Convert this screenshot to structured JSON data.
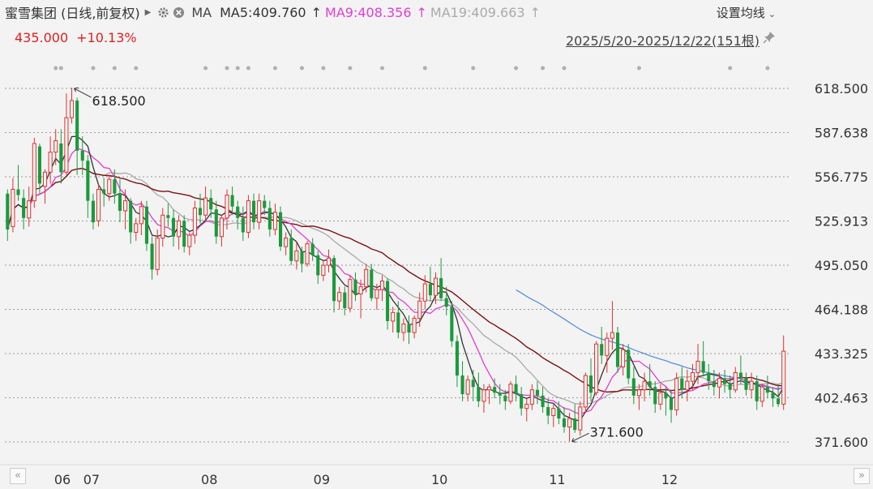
{
  "header": {
    "stock_name": "蜜雪集团 (日线,前复权)",
    "ma_label": "MA",
    "ma5": "MA5:409.760",
    "ma9": "MA9:408.356",
    "ma19": "MA19:409.663",
    "settings_label": "设置均线",
    "price": "435.000",
    "change": "+10.13%",
    "date_range": "2025/5/20-2025/12/22(151根)"
  },
  "colors": {
    "up": "#e03030",
    "down": "#1a9a3c",
    "ma5": "#333333",
    "ma9": "#e040d0",
    "ma19": "#aaaaaa",
    "ma_long": "#7a1010",
    "ma_blue": "#5b8fd8"
  },
  "icons": {
    "settings": "gear-icon",
    "close": "close-icon",
    "pin": "pin-icon",
    "nav_left": "double-left-icon",
    "nav_right": "double-right-icon"
  },
  "chart_data": {
    "type": "candlestick",
    "title": "蜜雪集团 (日线,前复权)",
    "y_ticks": [
      "618.500",
      "587.638",
      "556.775",
      "525.913",
      "495.050",
      "464.188",
      "433.325",
      "402.463",
      "371.600"
    ],
    "ylim": [
      371.6,
      618.5
    ],
    "x_ticks": [
      "06",
      "07",
      "08",
      "09",
      "10",
      "11",
      "12"
    ],
    "grid": true,
    "annotations": [
      {
        "label": "618.500",
        "type": "high"
      },
      {
        "label": "371.600",
        "type": "low"
      }
    ],
    "series": [
      {
        "name": "MA5",
        "last": 409.76
      },
      {
        "name": "MA9",
        "last": 408.356
      },
      {
        "name": "MA19",
        "last": 409.663
      }
    ],
    "ohlc": [
      [
        545,
        548,
        512,
        520
      ],
      [
        522,
        556,
        518,
        548
      ],
      [
        548,
        565,
        540,
        544
      ],
      [
        542,
        548,
        520,
        528
      ],
      [
        528,
        550,
        522,
        540
      ],
      [
        540,
        584,
        535,
        580
      ],
      [
        578,
        580,
        545,
        552
      ],
      [
        550,
        562,
        538,
        560
      ],
      [
        560,
        585,
        552,
        574
      ],
      [
        574,
        590,
        565,
        582
      ],
      [
        580,
        590,
        552,
        560
      ],
      [
        560,
        615,
        558,
        598
      ],
      [
        598,
        619,
        594,
        610
      ],
      [
        610,
        612,
        558,
        575
      ],
      [
        575,
        585,
        558,
        568
      ],
      [
        568,
        572,
        528,
        540
      ],
      [
        540,
        545,
        520,
        525
      ],
      [
        526,
        552,
        522,
        548
      ],
      [
        548,
        556,
        536,
        545
      ],
      [
        545,
        558,
        540,
        555
      ],
      [
        555,
        562,
        538,
        545
      ],
      [
        545,
        555,
        525,
        533
      ],
      [
        533,
        548,
        520,
        540
      ],
      [
        540,
        542,
        510,
        518
      ],
      [
        518,
        528,
        512,
        524
      ],
      [
        524,
        540,
        516,
        536
      ],
      [
        536,
        540,
        505,
        510
      ],
      [
        510,
        515,
        485,
        492
      ],
      [
        492,
        520,
        488,
        514
      ],
      [
        514,
        535,
        508,
        530
      ],
      [
        530,
        538,
        522,
        528
      ],
      [
        528,
        534,
        508,
        515
      ],
      [
        515,
        530,
        506,
        526
      ],
      [
        526,
        530,
        504,
        508
      ],
      [
        508,
        518,
        502,
        516
      ],
      [
        516,
        540,
        510,
        535
      ],
      [
        535,
        545,
        524,
        530
      ],
      [
        530,
        550,
        526,
        542
      ],
      [
        542,
        548,
        528,
        534
      ],
      [
        534,
        540,
        510,
        515
      ],
      [
        515,
        530,
        508,
        528
      ],
      [
        528,
        548,
        520,
        544
      ],
      [
        544,
        550,
        530,
        536
      ],
      [
        536,
        540,
        520,
        528
      ],
      [
        528,
        536,
        512,
        518
      ],
      [
        518,
        544,
        514,
        540
      ],
      [
        540,
        545,
        520,
        525
      ],
      [
        525,
        545,
        520,
        540
      ],
      [
        540,
        544,
        530,
        535
      ],
      [
        535,
        540,
        515,
        520
      ],
      [
        520,
        538,
        516,
        532
      ],
      [
        532,
        536,
        505,
        508
      ],
      [
        508,
        518,
        502,
        514
      ],
      [
        514,
        520,
        495,
        498
      ],
      [
        498,
        512,
        492,
        505
      ],
      [
        505,
        508,
        490,
        496
      ],
      [
        496,
        512,
        494,
        510
      ],
      [
        510,
        514,
        498,
        502
      ],
      [
        502,
        505,
        482,
        488
      ],
      [
        488,
        498,
        484,
        495
      ],
      [
        495,
        506,
        490,
        500
      ],
      [
        500,
        502,
        462,
        470
      ],
      [
        470,
        480,
        464,
        476
      ],
      [
        476,
        480,
        460,
        465
      ],
      [
        465,
        488,
        462,
        485
      ],
      [
        485,
        490,
        470,
        475
      ],
      [
        475,
        485,
        458,
        480
      ],
      [
        480,
        496,
        476,
        492
      ],
      [
        492,
        496,
        470,
        472
      ],
      [
        472,
        482,
        464,
        478
      ],
      [
        478,
        488,
        470,
        484
      ],
      [
        484,
        486,
        450,
        456
      ],
      [
        456,
        466,
        448,
        462
      ],
      [
        462,
        470,
        444,
        448
      ],
      [
        448,
        458,
        442,
        454
      ],
      [
        454,
        460,
        440,
        448
      ],
      [
        448,
        460,
        444,
        458
      ],
      [
        458,
        476,
        452,
        470
      ],
      [
        470,
        488,
        464,
        482
      ],
      [
        482,
        494,
        470,
        474
      ],
      [
        474,
        490,
        468,
        486
      ],
      [
        486,
        500,
        470,
        472
      ],
      [
        472,
        480,
        460,
        466
      ],
      [
        466,
        470,
        438,
        442
      ],
      [
        442,
        446,
        410,
        418
      ],
      [
        418,
        428,
        400,
        405
      ],
      [
        405,
        418,
        400,
        415
      ],
      [
        415,
        422,
        400,
        410
      ],
      [
        410,
        420,
        396,
        400
      ],
      [
        400,
        412,
        392,
        408
      ],
      [
        408,
        412,
        398,
        410
      ],
      [
        410,
        416,
        402,
        406
      ],
      [
        406,
        412,
        398,
        404
      ],
      [
        404,
        408,
        394,
        400
      ],
      [
        400,
        414,
        398,
        412
      ],
      [
        412,
        418,
        400,
        405
      ],
      [
        405,
        410,
        390,
        395
      ],
      [
        395,
        402,
        386,
        398
      ],
      [
        398,
        412,
        394,
        408
      ],
      [
        408,
        414,
        398,
        404
      ],
      [
        404,
        410,
        392,
        396
      ],
      [
        396,
        402,
        384,
        390
      ],
      [
        390,
        398,
        382,
        395
      ],
      [
        395,
        400,
        384,
        388
      ],
      [
        388,
        396,
        378,
        382
      ],
      [
        382,
        392,
        372,
        388
      ],
      [
        388,
        398,
        378,
        380
      ],
      [
        380,
        400,
        376,
        396
      ],
      [
        396,
        420,
        392,
        418
      ],
      [
        418,
        430,
        400,
        406
      ],
      [
        406,
        442,
        404,
        440
      ],
      [
        440,
        452,
        426,
        432
      ],
      [
        432,
        448,
        420,
        444
      ],
      [
        444,
        470,
        436,
        448
      ],
      [
        448,
        452,
        420,
        424
      ],
      [
        424,
        440,
        418,
        436
      ],
      [
        436,
        440,
        412,
        416
      ],
      [
        416,
        424,
        398,
        404
      ],
      [
        404,
        412,
        394,
        408
      ],
      [
        408,
        420,
        400,
        414
      ],
      [
        414,
        426,
        404,
        410
      ],
      [
        410,
        414,
        392,
        398
      ],
      [
        398,
        412,
        394,
        406
      ],
      [
        406,
        410,
        390,
        402
      ],
      [
        402,
        408,
        385,
        394
      ],
      [
        394,
        420,
        390,
        416
      ],
      [
        416,
        424,
        402,
        408
      ],
      [
        408,
        422,
        400,
        414
      ],
      [
        414,
        426,
        408,
        420
      ],
      [
        420,
        440,
        412,
        428
      ],
      [
        428,
        442,
        418,
        420
      ],
      [
        420,
        426,
        408,
        414
      ],
      [
        414,
        422,
        404,
        410
      ],
      [
        410,
        420,
        402,
        416
      ],
      [
        416,
        422,
        406,
        412
      ],
      [
        412,
        418,
        402,
        408
      ],
      [
        408,
        424,
        406,
        420
      ],
      [
        420,
        432,
        412,
        416
      ],
      [
        416,
        420,
        404,
        408
      ],
      [
        408,
        420,
        402,
        414
      ],
      [
        414,
        418,
        394,
        400
      ],
      [
        400,
        412,
        396,
        410
      ],
      [
        410,
        418,
        402,
        406
      ],
      [
        406,
        410,
        396,
        402
      ],
      [
        402,
        412,
        396,
        398
      ],
      [
        398,
        446,
        394,
        435
      ]
    ]
  }
}
